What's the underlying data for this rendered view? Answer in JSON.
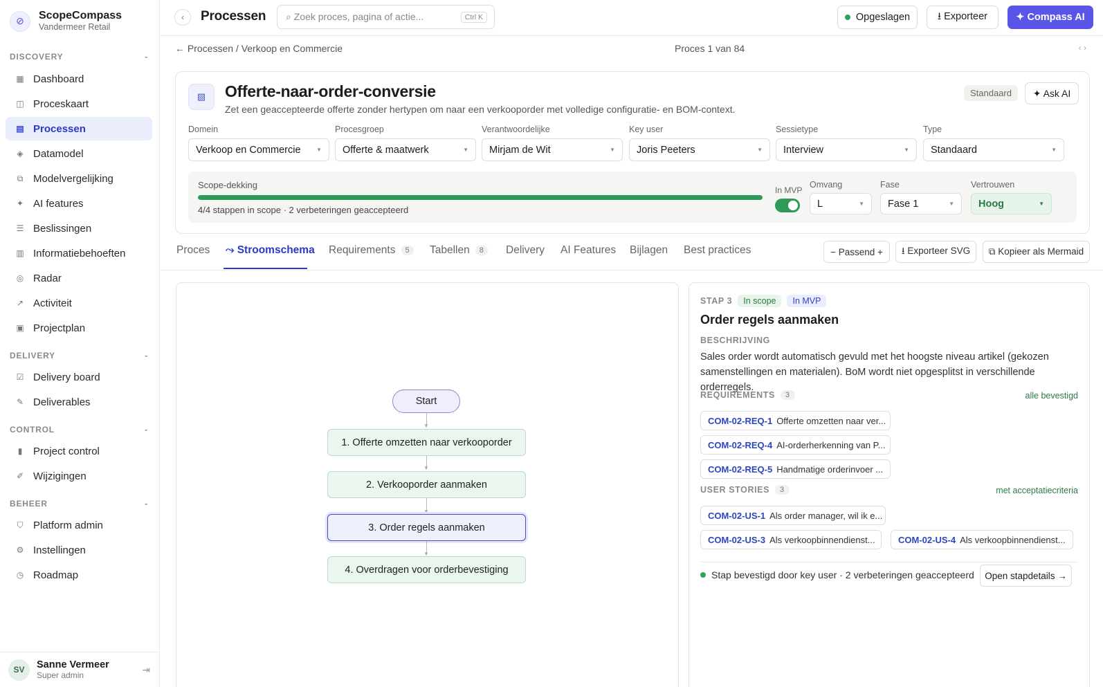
{
  "brand": {
    "name": "ScopeCompass",
    "sub": "Vandermeer Retail"
  },
  "sidebar": {
    "sections": [
      {
        "label": "DISCOVERY",
        "toggle": "-"
      },
      {
        "label": "DELIVERY",
        "toggle": "-"
      },
      {
        "label": "CONTROL",
        "toggle": "-"
      },
      {
        "label": "BEHEER",
        "toggle": "-"
      }
    ],
    "items": [
      {
        "label": "Dashboard",
        "icon": "▦"
      },
      {
        "label": "Proceskaart",
        "icon": "◫"
      },
      {
        "label": "Processen",
        "icon": "▤"
      },
      {
        "label": "Datamodel",
        "icon": "◈"
      },
      {
        "label": "Modelvergelijking",
        "icon": "⧉"
      },
      {
        "label": "AI features",
        "icon": "✦"
      },
      {
        "label": "Beslissingen",
        "icon": "☰"
      },
      {
        "label": "Informatiebehoeften",
        "icon": "▥"
      },
      {
        "label": "Radar",
        "icon": "◎"
      },
      {
        "label": "Activiteit",
        "icon": "↗"
      },
      {
        "label": "Projectplan",
        "icon": "▣"
      },
      {
        "label": "Delivery board",
        "icon": "☑"
      },
      {
        "label": "Deliverables",
        "icon": "✎"
      },
      {
        "label": "Project control",
        "icon": "▮"
      },
      {
        "label": "Wijzigingen",
        "icon": "✐"
      },
      {
        "label": "Platform admin",
        "icon": "⛉"
      },
      {
        "label": "Instellingen",
        "icon": "⚙"
      },
      {
        "label": "Roadmap",
        "icon": "◷"
      }
    ]
  },
  "user": {
    "initials": "SV",
    "name": "Sanne Vermeer",
    "role": "Super admin",
    "logout_icon": "⇥"
  },
  "topbar": {
    "collapse": "‹",
    "title": "Processen",
    "search_placeholder": "⌕  Zoek proces, pagina of actie...",
    "search_shortcut": "Ctrl K",
    "saved": "Opgeslagen",
    "export": "⭳  Exporteer",
    "ai": "✦  Compass AI"
  },
  "crumbs": {
    "path": "← Processen / Verkoop en Commercie",
    "pager": "Proces 1 van 84",
    "arrows": "‹ ›"
  },
  "process": {
    "icon": "▧",
    "title": "Offerte-naar-order-conversie",
    "description": "Zet een geaccepteerde offerte zonder hertypen om naar een verkooporder met volledige configuratie- en BOM-context.",
    "badge": "Standaard",
    "ask_ai": "✦ Ask AI",
    "fields": [
      {
        "label": "Domein",
        "value": "Verkoop en Commercie"
      },
      {
        "label": "Procesgroep",
        "value": "Offerte & maatwerk"
      },
      {
        "label": "Verantwoordelijke",
        "value": "Mirjam de Wit"
      },
      {
        "label": "Key user",
        "value": "Joris Peeters"
      },
      {
        "label": "Sessietype",
        "value": "Interview"
      },
      {
        "label": "Type",
        "value": "Standaard"
      }
    ],
    "scope": {
      "label": "Scope-dekking",
      "progress": 1.0,
      "summary": "4/4 stappen in scope · 2 verbeteringen geaccepteerd",
      "mvp_label": "In MVP",
      "mvp": true,
      "omvang_label": "Omvang",
      "omvang": "L",
      "fase_label": "Fase",
      "fase": "Fase 1",
      "vertrouwen_label": "Vertrouwen",
      "vertrouwen": "Hoog"
    }
  },
  "tabs": [
    {
      "label": "Proces"
    },
    {
      "label": "⤳ Stroomschema"
    },
    {
      "label": "Requirements",
      "count": "5"
    },
    {
      "label": "Tabellen",
      "count": "8"
    },
    {
      "label": "Delivery"
    },
    {
      "label": "AI Features"
    },
    {
      "label": "Bijlagen"
    },
    {
      "label": "Best practices"
    }
  ],
  "actions": {
    "zoom": "− Passend +",
    "export_svg": "⭳ Exporteer SVG",
    "mermaid": "⧉ Kopieer als Mermaid"
  },
  "flow": {
    "start": "Start",
    "steps": [
      "1. Offerte omzetten naar verkooporder",
      "2. Verkooporder aanmaken",
      "3. Order regels aanmaken",
      "4. Overdragen voor orderbevestiging"
    ]
  },
  "detail": {
    "step": "STAP 3",
    "scope_pill": "In scope",
    "mvp_pill": "In MVP",
    "title": "Order regels aanmaken",
    "desc_label": "BESCHRIJVING",
    "description": "Sales order wordt automatisch gevuld met het hoogste niveau artikel (gekozen samenstellingen en materialen). BoM wordt niet opgesplitst in verschillende orderregels.",
    "req_label": "REQUIREMENTS",
    "req_count": "3",
    "req_note": "alle bevestigd",
    "requirements": [
      {
        "id": "COM-02-REQ-1",
        "text": "Offerte omzetten naar ver..."
      },
      {
        "id": "COM-02-REQ-4",
        "text": "AI-orderherkenning van P..."
      },
      {
        "id": "COM-02-REQ-5",
        "text": "Handmatige orderinvoer ..."
      }
    ],
    "us_label": "USER STORIES",
    "us_count": "3",
    "us_note": "met acceptatiecriteria",
    "stories": [
      {
        "id": "COM-02-US-1",
        "text": "Als order manager, wil ik e..."
      },
      {
        "id": "COM-02-US-3",
        "text": "Als verkoopbinnendienst..."
      },
      {
        "id": "COM-02-US-4",
        "text": "Als verkoopbinnendienst..."
      }
    ],
    "footer": "Stap bevestigd door key user · 2 verbeteringen geaccepteerd",
    "open": "Open stapdetails →"
  }
}
